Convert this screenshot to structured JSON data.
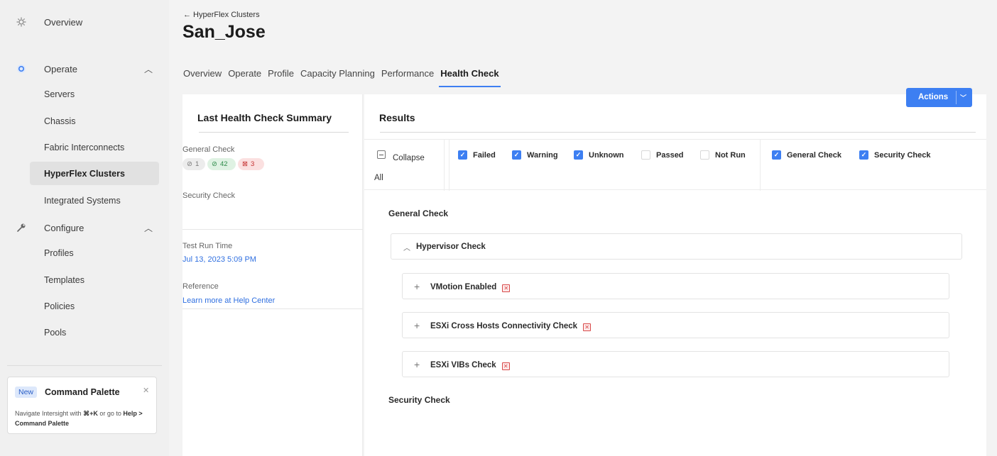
{
  "sidebar": {
    "overview": "Overview",
    "operate": {
      "label": "Operate",
      "items": [
        "Servers",
        "Chassis",
        "Fabric Interconnects",
        "HyperFlex Clusters",
        "Integrated Systems"
      ]
    },
    "configure": {
      "label": "Configure",
      "items": [
        "Profiles",
        "Templates",
        "Policies",
        "Pools"
      ]
    },
    "active_item": "HyperFlex Clusters",
    "command_palette": {
      "badge": "New",
      "title": "Command Palette",
      "desc_prefix": "Navigate Intersight with",
      "shortcut": "⌘+K",
      "desc_mid": "or go to",
      "path": "Help > Command Palette"
    }
  },
  "header": {
    "breadcrumb": "← HyperFlex Clusters",
    "title": "San_Jose",
    "tabs": [
      "Overview",
      "Operate",
      "Profile",
      "Capacity Planning",
      "Performance",
      "Health Check"
    ],
    "active_tab": "Health Check",
    "actions_label": "Actions"
  },
  "summary": {
    "title": "Last Health Check Summary",
    "general_check_label": "General Check",
    "badges": {
      "unknown": "1",
      "passed": "42",
      "failed": "3"
    },
    "security_check_label": "Security Check",
    "test_run_label": "Test Run Time",
    "test_run_value": "Jul 13, 2023 5:09 PM",
    "reference_label": "Reference",
    "reference_link": "Learn more at Help Center"
  },
  "results": {
    "title": "Results",
    "collapse_label": "Collapse",
    "collapse_all": "All",
    "status_filters": [
      {
        "label": "Failed",
        "checked": true
      },
      {
        "label": "Warning",
        "checked": true
      },
      {
        "label": "Unknown",
        "checked": true
      },
      {
        "label": "Passed",
        "checked": false
      },
      {
        "label": "Not Run",
        "checked": false
      }
    ],
    "type_filters": [
      {
        "label": "General Check",
        "checked": true
      },
      {
        "label": "Security Check",
        "checked": true
      }
    ],
    "general_section": "General Check",
    "group": "Hypervisor Check",
    "checks": [
      "VMotion Enabled",
      "ESXi Cross Hosts Connectivity Check",
      "ESXi VIBs Check"
    ],
    "security_section": "Security Check"
  },
  "colors": {
    "accent": "#3d7ff2",
    "fail": "#d84a4a",
    "pass": "#2c8a48"
  },
  "icons": {
    "overview": "dashboard-icon",
    "operate": "operate-icon",
    "configure": "wrench-icon"
  }
}
